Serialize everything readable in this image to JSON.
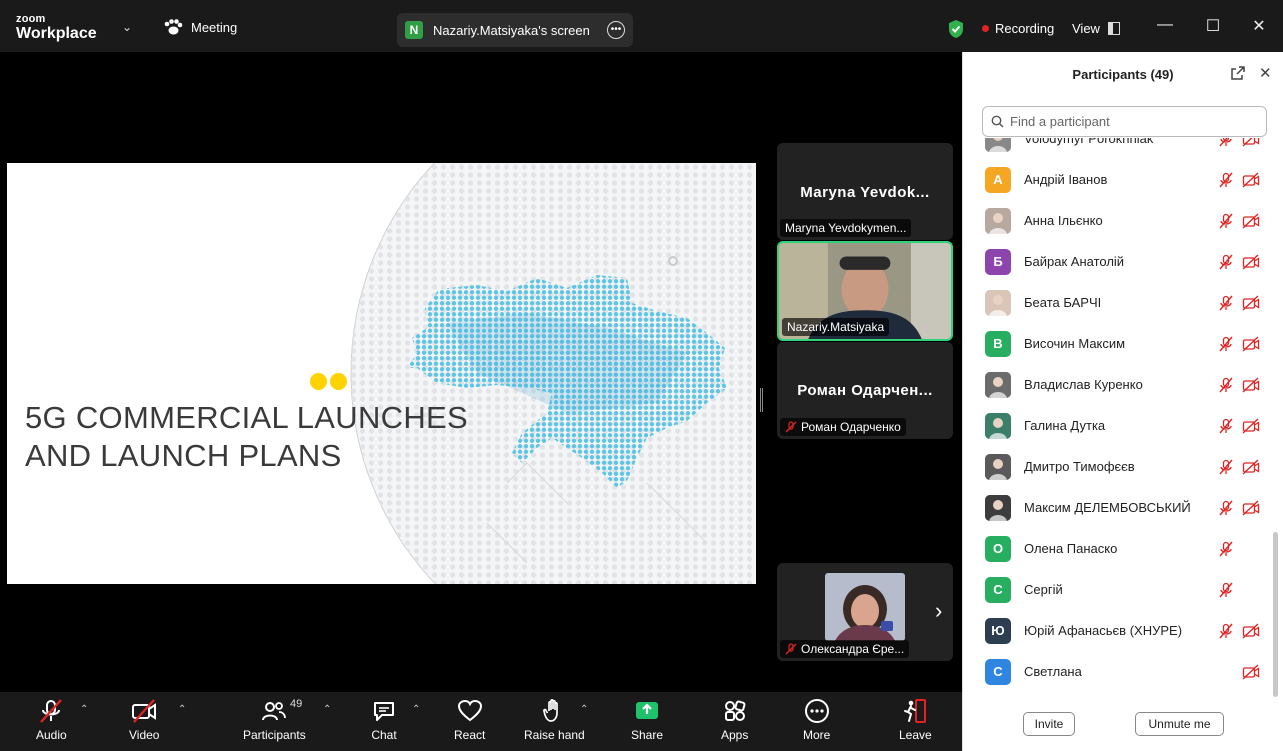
{
  "app": {
    "logo_small": "zoom",
    "logo_big": "Workplace",
    "meeting_label": "Meeting",
    "share_badge": "N",
    "share_label": "Nazariy.Matsiyaka's screen",
    "recording_label": "Recording",
    "view_label": "View"
  },
  "slide": {
    "title_line1": "5G COMMERCIAL LAUNCHES",
    "title_line2": "AND LAUNCH PLANS"
  },
  "videos": [
    {
      "big_name": "Maryna Yevdok...",
      "label": "Maryna Yevdokymen..."
    },
    {
      "label": "Nazariy.Matsiyaka"
    },
    {
      "big_name": "Роман Одарчен...",
      "label": "Роман Одарченко"
    },
    {
      "label": "Олександра Єре..."
    }
  ],
  "toolbar": {
    "audio": "Audio",
    "video": "Video",
    "participants": "Participants",
    "participants_count": "49",
    "chat": "Chat",
    "react": "React",
    "raise_hand": "Raise hand",
    "share": "Share",
    "apps": "Apps",
    "more": "More",
    "leave": "Leave"
  },
  "panel": {
    "title": "Participants (49)",
    "search_placeholder": "Find a participant",
    "invite": "Invite",
    "unmute_me": "Unmute me"
  },
  "participants": [
    {
      "name": "Volodymyr Poroknniak",
      "initial": "",
      "color": "#888888",
      "photo": true,
      "mic_muted": true,
      "cam_off": true
    },
    {
      "name": "Андрій Іванов",
      "initial": "А",
      "color": "#f5a623",
      "photo": false,
      "mic_muted": true,
      "cam_off": true
    },
    {
      "name": "Анна Ільєнко",
      "initial": "",
      "color": "#b8a9a0",
      "photo": true,
      "mic_muted": true,
      "cam_off": true
    },
    {
      "name": "Байрак Анатолій",
      "initial": "Б",
      "color": "#8e44ad",
      "photo": false,
      "mic_muted": true,
      "cam_off": true
    },
    {
      "name": "Беата БАРЧІ",
      "initial": "",
      "color": "#d9c6b8",
      "photo": true,
      "mic_muted": true,
      "cam_off": true
    },
    {
      "name": "Височин Максим",
      "initial": "В",
      "color": "#27ae60",
      "photo": false,
      "mic_muted": true,
      "cam_off": true
    },
    {
      "name": "Владислав Куренко",
      "initial": "",
      "color": "#6b6b6b",
      "photo": true,
      "mic_muted": true,
      "cam_off": true
    },
    {
      "name": "Галина Дутка",
      "initial": "",
      "color": "#3b7f6b",
      "photo": true,
      "mic_muted": true,
      "cam_off": true
    },
    {
      "name": "Дмитро Тимофєєв",
      "initial": "",
      "color": "#5a5a5a",
      "photo": true,
      "mic_muted": true,
      "cam_off": true
    },
    {
      "name": "Максим ДЕЛЕМБОВСЬКИЙ",
      "initial": "",
      "color": "#3d3d3d",
      "photo": true,
      "mic_muted": true,
      "cam_off": true
    },
    {
      "name": "Олена Панаско",
      "initial": "О",
      "color": "#27ae60",
      "photo": false,
      "mic_muted": true,
      "cam_off": false
    },
    {
      "name": "Сергій",
      "initial": "С",
      "color": "#27ae60",
      "photo": false,
      "mic_muted": true,
      "cam_off": false
    },
    {
      "name": "Юрій Афанасьєв (ХНУРЕ)",
      "initial": "Ю",
      "color": "#2c3e50",
      "photo": false,
      "mic_muted": true,
      "cam_off": true
    },
    {
      "name": "Светлана",
      "initial": "С",
      "color": "#2e86de",
      "photo": false,
      "mic_muted": false,
      "cam_off": true
    }
  ]
}
